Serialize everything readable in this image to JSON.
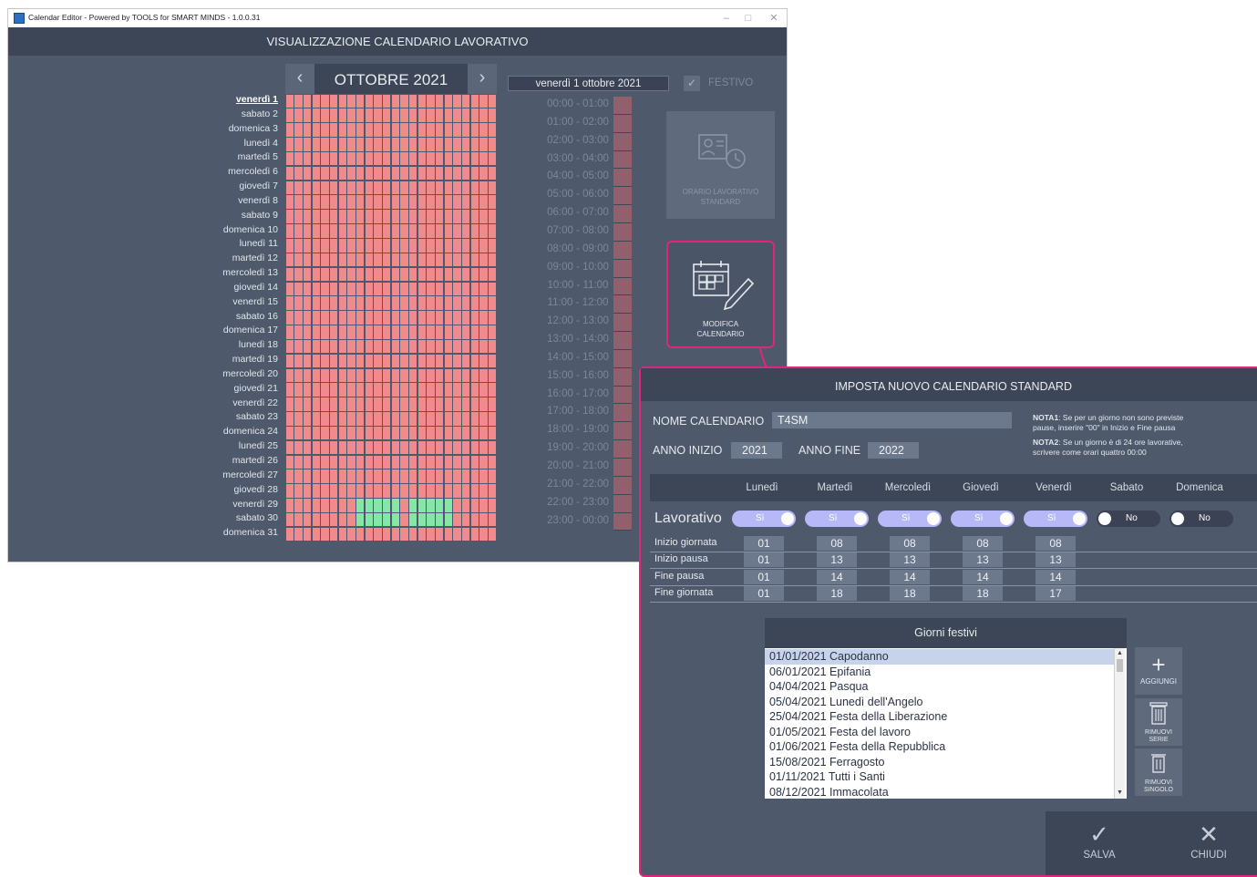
{
  "window": {
    "title": "Calendar Editor - Powered by TOOLS for SMART MINDS - 1.0.0.31",
    "header": "VISUALIZZAZIONE CALENDARIO LAVORATIVO",
    "controls": {
      "minimize": "–",
      "maximize": "□",
      "close": "✕"
    }
  },
  "calendar": {
    "prev_symbol": "‹",
    "next_symbol": "›",
    "month_title": "OTTOBRE 2021",
    "days": [
      "venerdì 1",
      "sabato 2",
      "domenica 3",
      "lunedì 4",
      "martedì 5",
      "mercoledì 6",
      "giovedì 7",
      "venerdì 8",
      "sabato 9",
      "domenica 10",
      "lunedì 11",
      "martedì 12",
      "mercoledì 13",
      "giovedì 14",
      "venerdì 15",
      "sabato 16",
      "domenica 17",
      "lunedì 18",
      "martedì 19",
      "mercoledì 20",
      "giovedì 21",
      "venerdì 22",
      "sabato 23",
      "domenica 24",
      "lunedì 25",
      "martedì 26",
      "mercoledì 27",
      "giovedì 28",
      "venerdì 29",
      "sabato 30",
      "domenica 31"
    ],
    "selected_day_index": 0,
    "green_slots_day_index": [
      28,
      29
    ],
    "green_slots": [
      8,
      9,
      10,
      11,
      12,
      14,
      15,
      16,
      17,
      18
    ],
    "slots_per_day": 24,
    "colors": {
      "closed": "#f08a8c",
      "open": "#86e6a9"
    }
  },
  "detail": {
    "date": "venerdì 1 ottobre 2021",
    "festivo_check": "✓",
    "festivo_label": "FESTIVO",
    "hours": [
      "00:00 - 01:00",
      "01:00 - 02:00",
      "02:00 - 03:00",
      "03:00 - 04:00",
      "04:00 - 05:00",
      "05:00 - 06:00",
      "06:00 - 07:00",
      "07:00 - 08:00",
      "08:00 - 09:00",
      "09:00 - 10:00",
      "10:00 - 11:00",
      "11:00 - 12:00",
      "12:00 - 13:00",
      "13:00 - 14:00",
      "14:00 - 15:00",
      "15:00 - 16:00",
      "16:00 - 17:00",
      "17:00 - 18:00",
      "18:00 - 19:00",
      "19:00 - 20:00",
      "20:00 - 21:00",
      "21:00 - 22:00",
      "22:00 - 23:00",
      "23:00 - 00:00"
    ]
  },
  "actions": {
    "orario_line1": "ORARIO LAVORATIVO",
    "orario_line2": "STANDARD",
    "modifica_line1": "MODIFICA",
    "modifica_line2": "CALENDARIO"
  },
  "dialog": {
    "title": "IMPOSTA NUOVO CALENDARIO STANDARD",
    "name_label": "NOME CALENDARIO",
    "name_value": "T4SM",
    "anno_inizio_label": "ANNO INIZIO",
    "anno_inizio_value": "2021",
    "anno_fine_label": "ANNO FINE",
    "anno_fine_value": "2022",
    "nota1_title": "NOTA1",
    "nota1_line1": ": Se per un giorno non sono previste",
    "nota1_line2": "pause, inserire \"00\" in Inizio e Fine pausa",
    "nota2_title": "NOTA2",
    "nota2_line1": ": Se un giorno è di 24 ore lavorative,",
    "nota2_line2": "scrivere come orari quattro 00:00",
    "weekdays": [
      "Lunedì",
      "Martedì",
      "Mercoledì",
      "Giovedì",
      "Venerdì",
      "Sabato",
      "Domenica"
    ],
    "lavorativo_label": "Lavorativo",
    "lavorativo": [
      {
        "label": "Sì",
        "on": true
      },
      {
        "label": "Sì",
        "on": true
      },
      {
        "label": "Sì",
        "on": true
      },
      {
        "label": "Sì",
        "on": true
      },
      {
        "label": "Sì",
        "on": true
      },
      {
        "label": "No",
        "on": false
      },
      {
        "label": "No",
        "on": false
      }
    ],
    "rows": [
      {
        "label": "Inizio giornata",
        "values": [
          "01",
          "08",
          "08",
          "08",
          "08"
        ]
      },
      {
        "label": "Inizio pausa",
        "values": [
          "01",
          "13",
          "13",
          "13",
          "13"
        ]
      },
      {
        "label": "Fine pausa",
        "values": [
          "01",
          "14",
          "14",
          "14",
          "14"
        ]
      },
      {
        "label": "Fine giornata",
        "values": [
          "01",
          "18",
          "18",
          "18",
          "17"
        ]
      }
    ],
    "festivi_title": "Giorni festivi",
    "festivi": [
      "01/01/2021 Capodanno",
      "06/01/2021 Epifania",
      "04/04/2021 Pasqua",
      "05/04/2021 Lunedì dell'Angelo",
      "25/04/2021 Festa della Liberazione",
      "01/05/2021 Festa del lavoro",
      "01/06/2021 Festa della Repubblica",
      "15/08/2021 Ferragosto",
      "01/11/2021 Tutti i Santi",
      "08/12/2021 Immacolata"
    ],
    "aggiungi_label": "AGGIUNGI",
    "rimuovi_serie_line1": "RIMUOVI",
    "rimuovi_serie_line2": "SERIE",
    "rimuovi_singolo_line1": "RIMUOVI",
    "rimuovi_singolo_line2": "SINGOLO",
    "salva_label": "SALVA",
    "chiudi_label": "CHIUDI"
  },
  "colors": {
    "accent": "#e0267c",
    "panel": "#4e596b",
    "header": "#3d4657"
  }
}
